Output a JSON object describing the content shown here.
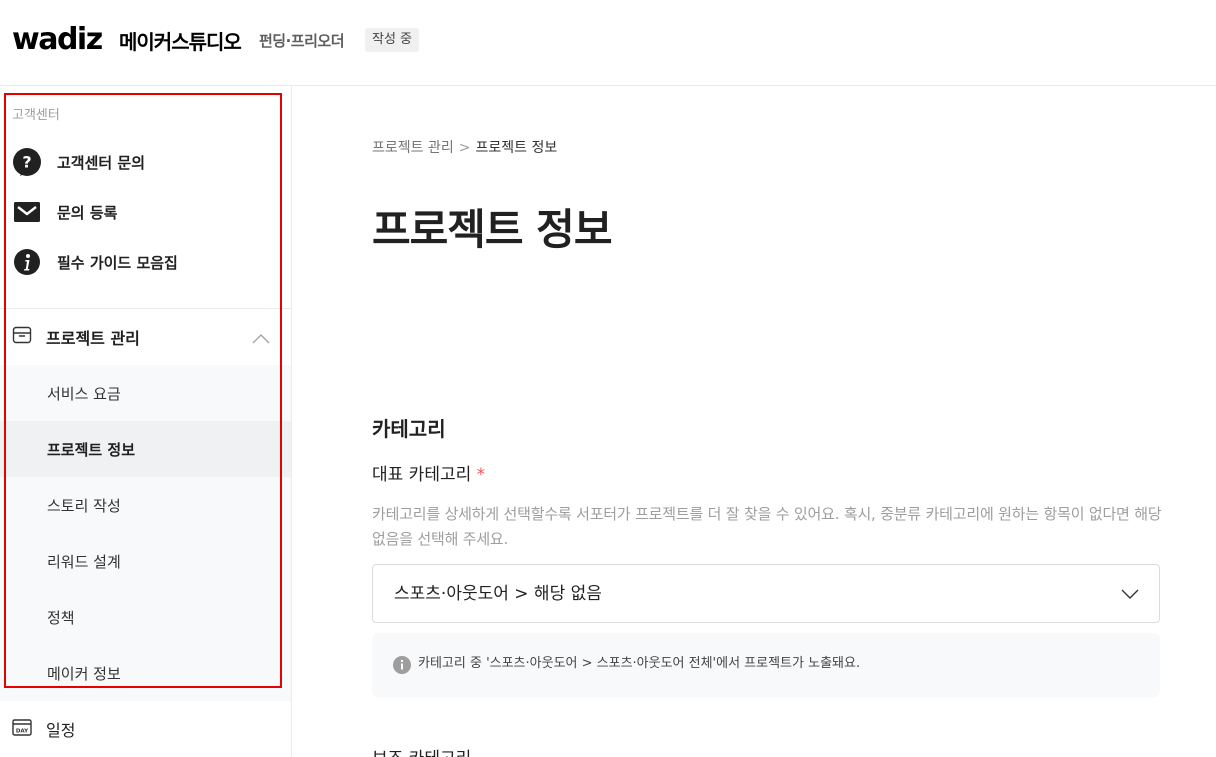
{
  "header": {
    "logo": "wadiz",
    "studio": "메이커스튜디오",
    "mode": "펀딩·프리오더",
    "status_badge": "작성 중"
  },
  "sidebar": {
    "support_title": "고객센터",
    "support_items": [
      {
        "label": "고객센터 문의",
        "icon": "question-icon"
      },
      {
        "label": "문의 등록",
        "icon": "mail-icon"
      },
      {
        "label": "필수 가이드 모음집",
        "icon": "info-icon"
      }
    ],
    "project_menu": {
      "label": "프로젝트 관리",
      "icon": "box-icon",
      "expanded": true,
      "items": [
        {
          "label": "서비스 요금",
          "active": false
        },
        {
          "label": "프로젝트 정보",
          "active": true
        },
        {
          "label": "스토리 작성",
          "active": false
        },
        {
          "label": "리워드 설계",
          "active": false
        },
        {
          "label": "정책",
          "active": false
        },
        {
          "label": "메이커 정보",
          "active": false
        }
      ]
    },
    "schedule": {
      "label": "일정",
      "icon": "calendar-day-icon",
      "icon_text": "DAY"
    }
  },
  "main": {
    "breadcrumb": {
      "parent": "프로젝트 관리",
      "separator": ">",
      "current": "프로젝트 정보"
    },
    "page_title": "프로젝트 정보",
    "category_section": {
      "title": "카테고리",
      "field_label": "대표 카테고리",
      "required_mark": "*",
      "help_text": "카테고리를 상세하게 선택할수록 서포터가 프로젝트를 더 잘 찾을 수 있어요. 혹시, 중분류 카테고리에 원하는 항목이 없다면 해당 없음을 선택해 주세요.",
      "selected_value": "스포츠·아웃도어 > 해당 없음",
      "info_text": "카테고리 중 '스포츠·아웃도어 > 스포츠·아웃도어 전체'에서 프로젝트가 노출돼요."
    },
    "next_section_label": "보조 카테고리"
  },
  "colors": {
    "required": "#f2555a",
    "highlight": "#e60000",
    "active_bg": "#f0f1f3",
    "sub_bg": "#f8f9fa"
  }
}
